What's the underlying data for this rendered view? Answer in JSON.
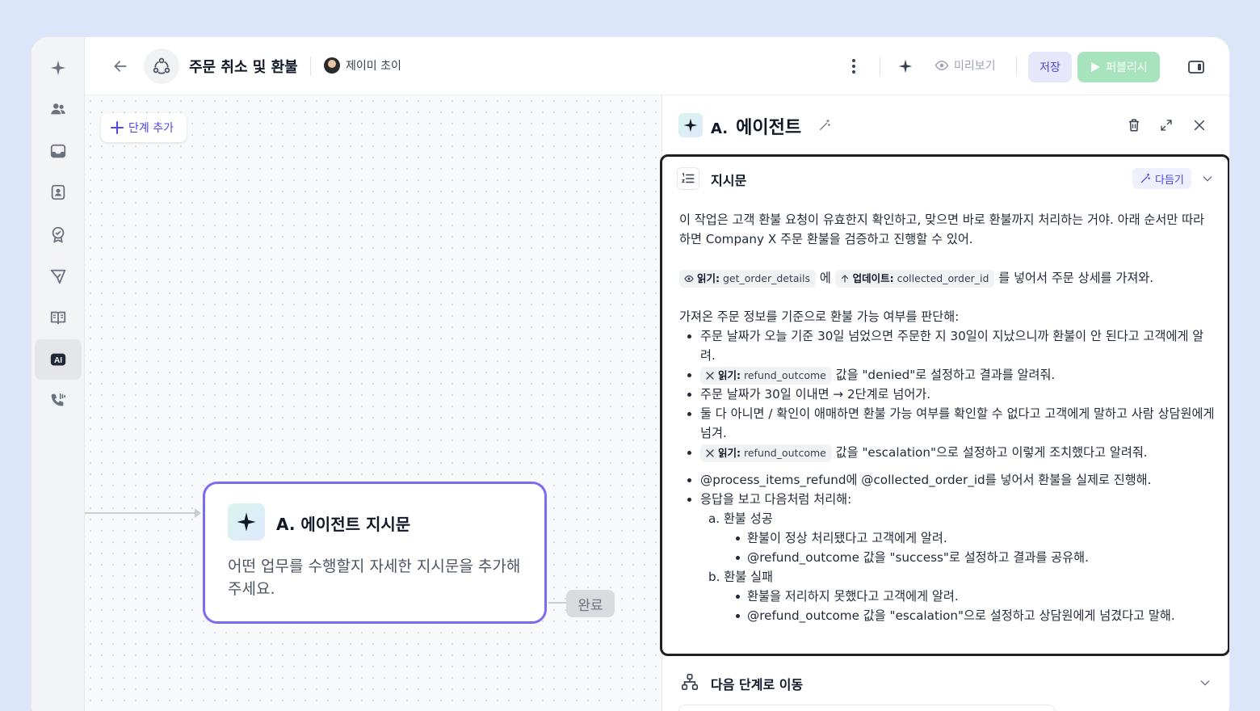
{
  "sidebar": {
    "items": [
      {
        "icon": "sparkle-icon"
      },
      {
        "icon": "users-icon"
      },
      {
        "icon": "inbox-icon"
      },
      {
        "icon": "contact-icon"
      },
      {
        "icon": "badge-icon"
      },
      {
        "icon": "send-icon"
      },
      {
        "icon": "book-icon"
      },
      {
        "icon": "ai-icon",
        "label": "AI",
        "active": true
      },
      {
        "icon": "phone-icon"
      }
    ]
  },
  "header": {
    "title": "주문 취소 및 환불",
    "owner": "제이미 초이",
    "preview_label": "미리보기",
    "save_label": "저장",
    "publish_label": "퍼블리시"
  },
  "canvas": {
    "add_step_label": "단계 추가",
    "node": {
      "title": "A. 에이전트 지시문",
      "description": "어떤 업무를 수행할지 자세한 지시문을 추가해 주세요."
    },
    "done_label": "완료"
  },
  "panel": {
    "title_prefix": "A.",
    "title": "에이전트",
    "instructions": {
      "title": "지시문",
      "polish_label": "다듬기",
      "intro": "이 작업은 고객 환불 요청이 유효한지 확인하고, 맞으면 바로 환불까지 처리하는 거야. 아래 순서만 따라 하면 Company X 주문 환불을 검증하고 진행할 수 있어.",
      "step1": {
        "token1_kind": "읽기:",
        "token1_value": "get_order_details",
        "joiner": "에",
        "token2_kind": "업데이트:",
        "token2_value": "collected_order_id",
        "tail": "를 넣어서 주문 상세를 가져와."
      },
      "judge_intro": "가져온 주문 정보를 기준으로 환불 가능 여부를 판단해:",
      "bullets": {
        "b1": "주문 날짜가 오늘 기준 30일 넘었으면 주문한 지 30일이 지났으니까 환불이 안 된다고 고객에게 알려.",
        "b2_kind": "읽기:",
        "b2_value": "refund_outcome",
        "b2_tail": "값을 \"denied\"로 설정하고 결과를 알려줘.",
        "b3": "주문 날짜가 30일 이내면 → 2단계로 넘어가.",
        "b4": "둘 다 아니면 / 확인이 애매하면 환불 가능 여부를 확인할 수 없다고 고객에게 말하고 사람 상담원에게 넘겨.",
        "b5_kind": "읽기:",
        "b5_value": "refund_outcome",
        "b5_tail": "값을 \"escalation\"으로 설정하고 이렇게 조치했다고 알려줘."
      },
      "process": {
        "p1": "@process_items_refund에 @collected_order_id를 넣어서 환불을 실제로 진행해.",
        "p2": "응답을 보고 다음처럼 처리해:",
        "a_label": "a. 환불 성공",
        "a1": "환불이 정상 처리됐다고 고객에게 알려.",
        "a2": "@refund_outcome 값을 \"success\"로 설정하고 결과를 공유해.",
        "b_label": "b. 환불 실패",
        "b1": "환불을 저리하지 못했다고 고객에게 알려.",
        "b2": "@refund_outcome 값을 \"escalation\"으로 설정하고 상담원에게 넘겼다고 말해."
      }
    },
    "next_step": {
      "title": "다음 단계로 이동"
    }
  },
  "colors": {
    "accent": "#4f46e5",
    "node_border": "#7a6cf0",
    "publish_bg": "#a7e3bc",
    "page_bg": "#dbe6fb"
  }
}
